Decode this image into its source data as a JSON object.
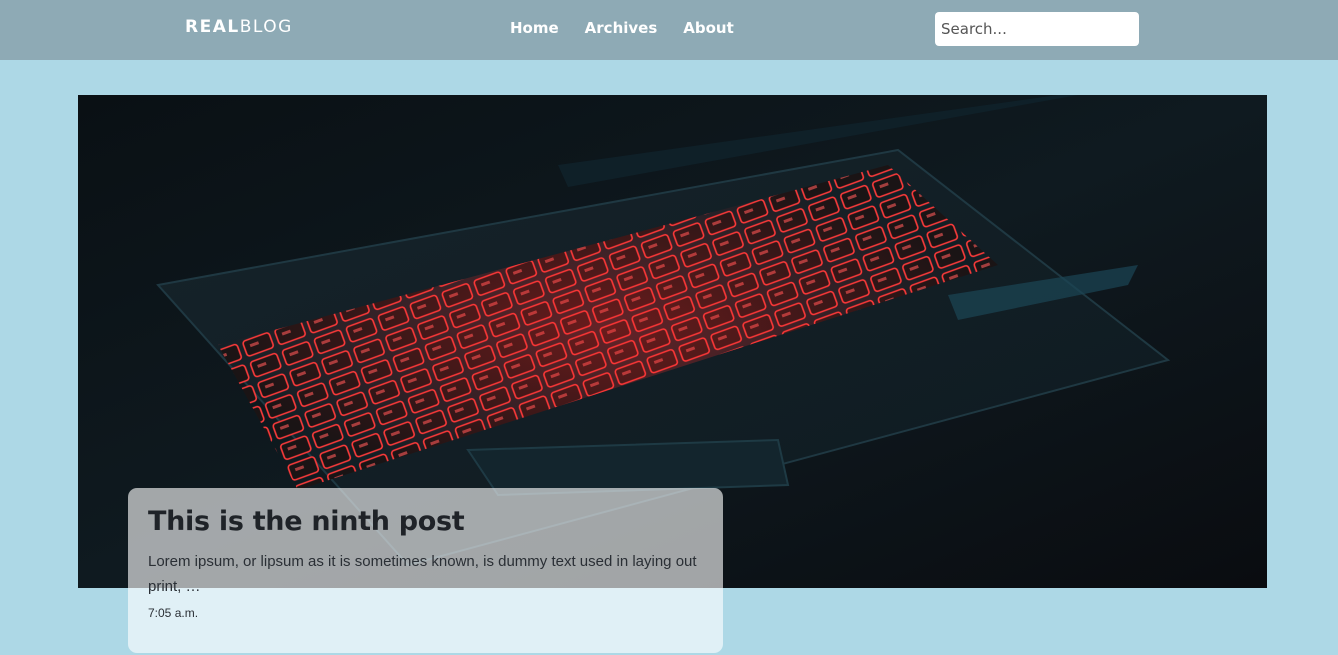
{
  "header": {
    "brand_bold": "REAL",
    "brand_light": "BLOG",
    "nav": [
      {
        "label": "Home"
      },
      {
        "label": "Archives"
      },
      {
        "label": "About"
      }
    ],
    "search": {
      "placeholder": "Search...",
      "value": ""
    }
  },
  "featured_post": {
    "image_subject": "laptop with red backlit keyboard",
    "title": "This is the ninth post",
    "excerpt": "Lorem ipsum, or lipsum as it is sometimes known, is dummy text used in laying out print, …",
    "time": "7:05 a.m."
  },
  "colors": {
    "page_background": "#add8e6",
    "navbar_background": "#8eaab5",
    "keyboard_glow": "#ff2a2a"
  }
}
